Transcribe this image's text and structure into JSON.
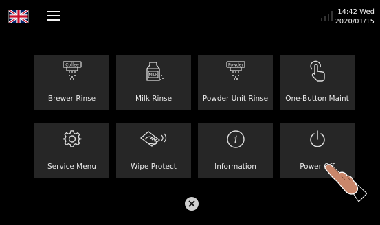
{
  "header": {
    "language": "en-gb",
    "language_icon": "uk-flag-icon",
    "menu_icon": "hamburger-menu-icon",
    "signal_icon": "signal-strength-icon",
    "time": "14:42 Wed",
    "date": "2020/01/15"
  },
  "tiles": [
    {
      "label": "Brewer Rinse",
      "icon": "brewer-rinse-icon",
      "icon_text": "Coffee"
    },
    {
      "label": "Milk Rinse",
      "icon": "milk-rinse-icon",
      "icon_text": "MILK"
    },
    {
      "label": "Powder Unit Rinse",
      "icon": "powder-rinse-icon",
      "icon_text": "Powder"
    },
    {
      "label": "One-Button Maint",
      "icon": "touch-icon"
    },
    {
      "label": "Service Menu",
      "icon": "gear-icon"
    },
    {
      "label": "Wipe Protect",
      "icon": "wipe-icon"
    },
    {
      "label": "Information",
      "icon": "info-icon",
      "icon_text": "i"
    },
    {
      "label": "Power Off",
      "icon": "power-icon"
    }
  ],
  "close_icon": "close-icon",
  "overlay_icon": "pointing-hand-icon",
  "colors": {
    "background": "#000000",
    "tile": "#262626",
    "text": "#e8e8e8"
  }
}
